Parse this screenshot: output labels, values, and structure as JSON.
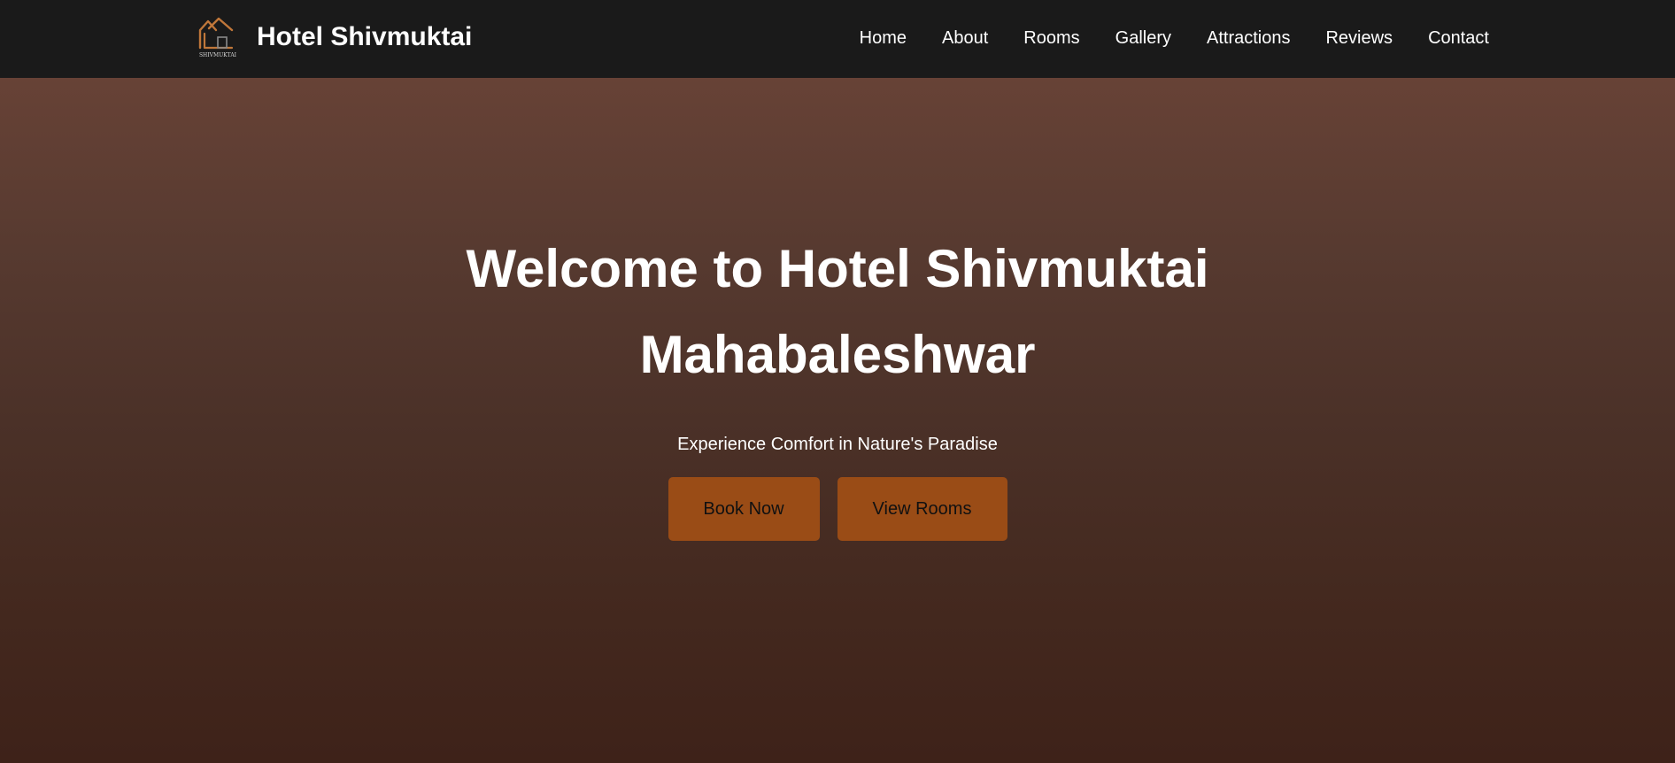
{
  "colors": {
    "navbar_bg": "#1a1a1a",
    "hero_top": "#674236",
    "hero_bottom": "#3e2219",
    "accent": "#9a4c16",
    "logo_orange": "#c0773a"
  },
  "brand": {
    "logo_icon": "house-logo-icon",
    "logo_text": "SHIVMUKTAI",
    "name": "Hotel Shivmuktai"
  },
  "nav": {
    "items": [
      {
        "label": "Home"
      },
      {
        "label": "About"
      },
      {
        "label": "Rooms"
      },
      {
        "label": "Gallery"
      },
      {
        "label": "Attractions"
      },
      {
        "label": "Reviews"
      },
      {
        "label": "Contact"
      }
    ]
  },
  "hero": {
    "title": "Welcome to Hotel Shivmuktai Mahabaleshwar",
    "subtitle": "Experience Comfort in Nature's Paradise",
    "buttons": {
      "book": "Book Now",
      "rooms": "View Rooms"
    }
  }
}
